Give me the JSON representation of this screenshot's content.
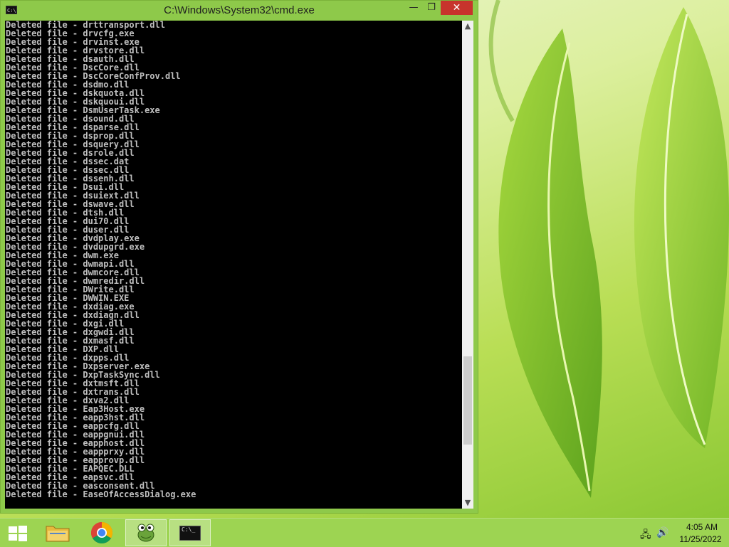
{
  "window": {
    "title": "C:\\Windows\\System32\\cmd.exe",
    "minimize_glyph": "—",
    "maximize_glyph": "❐",
    "close_glyph": "✕",
    "icon_text": "C:\\"
  },
  "console": {
    "lines": [
      "Deleted file - drttransport.dll",
      "Deleted file - drvcfg.exe",
      "Deleted file - drvinst.exe",
      "Deleted file - drvstore.dll",
      "Deleted file - dsauth.dll",
      "Deleted file - DscCore.dll",
      "Deleted file - DscCoreConfProv.dll",
      "Deleted file - dsdmo.dll",
      "Deleted file - dskquota.dll",
      "Deleted file - dskquoui.dll",
      "Deleted file - DsmUserTask.exe",
      "Deleted file - dsound.dll",
      "Deleted file - dsparse.dll",
      "Deleted file - dsprop.dll",
      "Deleted file - dsquery.dll",
      "Deleted file - dsrole.dll",
      "Deleted file - dssec.dat",
      "Deleted file - dssec.dll",
      "Deleted file - dssenh.dll",
      "Deleted file - Dsui.dll",
      "Deleted file - dsuiext.dll",
      "Deleted file - dswave.dll",
      "Deleted file - dtsh.dll",
      "Deleted file - dui70.dll",
      "Deleted file - duser.dll",
      "Deleted file - dvdplay.exe",
      "Deleted file - dvdupgrd.exe",
      "Deleted file - dwm.exe",
      "Deleted file - dwmapi.dll",
      "Deleted file - dwmcore.dll",
      "Deleted file - dwmredir.dll",
      "Deleted file - DWrite.dll",
      "Deleted file - DWWIN.EXE",
      "Deleted file - dxdiag.exe",
      "Deleted file - dxdiagn.dll",
      "Deleted file - dxgi.dll",
      "Deleted file - dxgwdi.dll",
      "Deleted file - dxmasf.dll",
      "Deleted file - DXP.dll",
      "Deleted file - dxpps.dll",
      "Deleted file - Dxpserver.exe",
      "Deleted file - DxpTaskSync.dll",
      "Deleted file - dxtmsft.dll",
      "Deleted file - dxtrans.dll",
      "Deleted file - dxva2.dll",
      "Deleted file - Eap3Host.exe",
      "Deleted file - eapp3hst.dll",
      "Deleted file - eappcfg.dll",
      "Deleted file - eappgnui.dll",
      "Deleted file - eapphost.dll",
      "Deleted file - eappprxy.dll",
      "Deleted file - eapprovp.dll",
      "Deleted file - EAPQEC.DLL",
      "Deleted file - eapsvc.dll",
      "Deleted file - easconsent.dll",
      "Deleted file - EaseOfAccessDialog.exe"
    ],
    "scroll_position": 0.86
  },
  "taskbar": {
    "items": [
      {
        "name": "start-button",
        "icon": "windows-logo-icon"
      },
      {
        "name": "file-explorer-button",
        "icon": "folder-icon"
      },
      {
        "name": "chrome-button",
        "icon": "chrome-icon"
      },
      {
        "name": "app-button",
        "icon": "frog-icon"
      },
      {
        "name": "cmd-button",
        "icon": "console-icon",
        "icon_text": "C:\\_"
      }
    ],
    "clock": {
      "time": "4:05 AM",
      "date": "11/25/2022"
    }
  },
  "colors": {
    "accent": "#8ec94a",
    "taskbar": "#9dd452",
    "close_button": "#c7342c",
    "console_bg": "#000000",
    "console_text": "#c0c0c0"
  }
}
